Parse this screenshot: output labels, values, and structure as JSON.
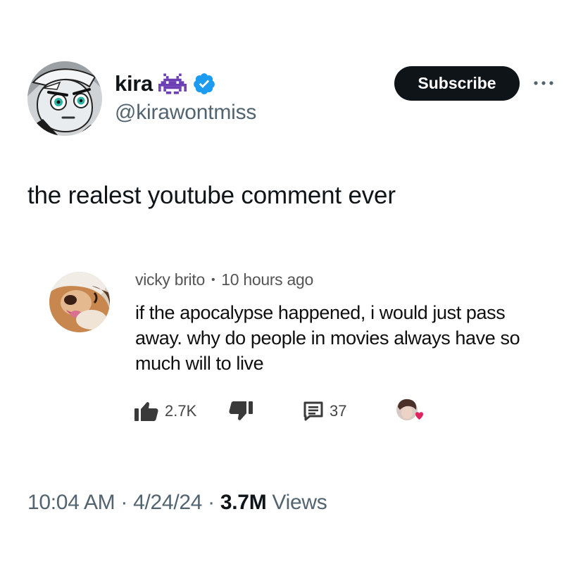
{
  "tweet": {
    "author": {
      "display_name": "kira",
      "handle": "@kirawontmiss",
      "badge_emoji_icon": "space-invader-icon",
      "verified_icon": "verified-badge-icon",
      "avatar_icon": "cartoon-avatar"
    },
    "subscribe_label": "Subscribe",
    "more_icon": "more-options-icon",
    "text": "the realest youtube comment ever",
    "timestamp": "10:04 AM",
    "date": "4/24/24",
    "separator": " · ",
    "views_count": "3.7M",
    "views_label": " Views"
  },
  "youtube_comment": {
    "author": "vicky brito",
    "dot": "•",
    "time_ago": "10 hours ago",
    "body": "if the apocalypse happened, i would just pass away. why do people in movies always have so much will to live",
    "likes": "2.7K",
    "replies": "37",
    "avatar_icon": "dog-photo-avatar",
    "creator_heart_icon": "creator-heart-icon"
  },
  "colors": {
    "text": "#0f1419",
    "secondary": "#536471",
    "verified": "#1d9bf0",
    "subscribe_bg": "#0f1419",
    "heart": "#e0245e"
  }
}
